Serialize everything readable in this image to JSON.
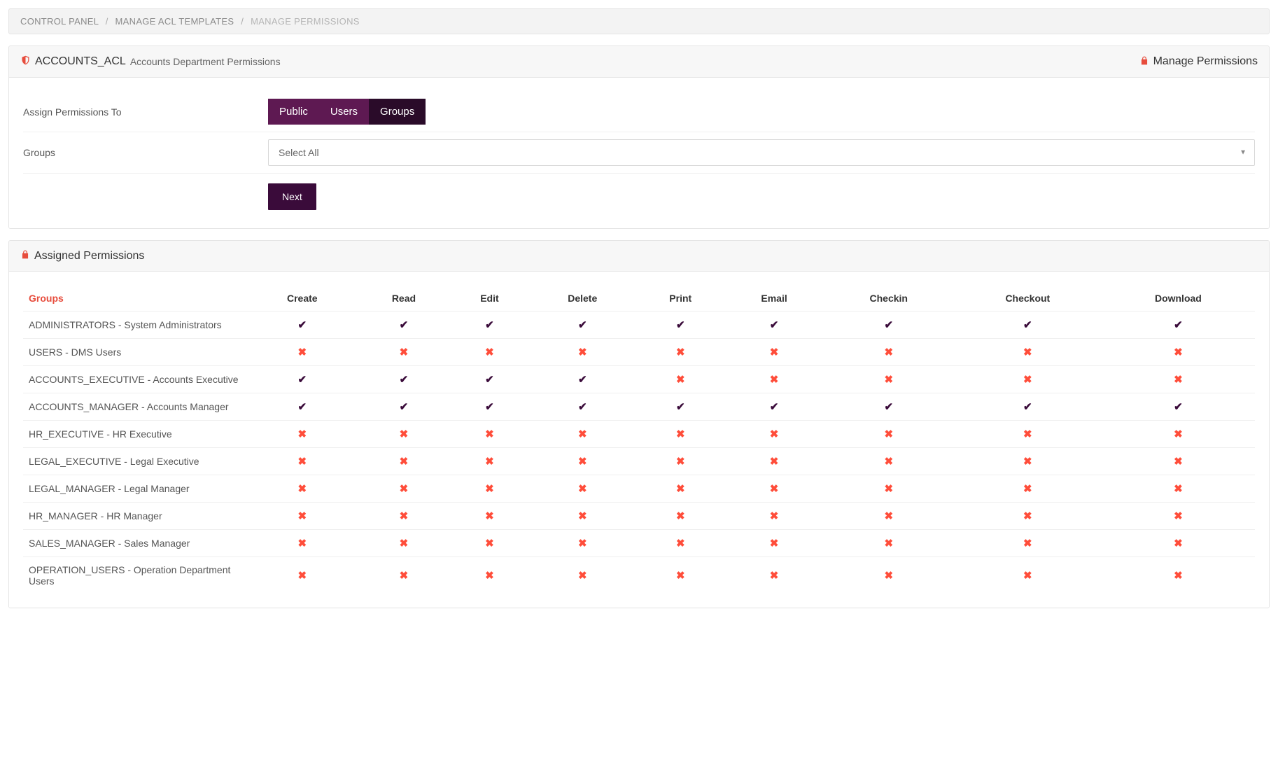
{
  "breadcrumb": {
    "items": [
      {
        "label": "CONTROL PANEL"
      },
      {
        "label": "MANAGE ACL TEMPLATES"
      },
      {
        "label": "MANAGE PERMISSIONS"
      }
    ]
  },
  "acl_panel": {
    "title_main": "ACCOUNTS_ACL",
    "title_sub": "Accounts Department Permissions",
    "header_right": "Manage Permissions",
    "assign_label": "Assign Permissions To",
    "tabs": [
      {
        "label": "Public"
      },
      {
        "label": "Users"
      },
      {
        "label": "Groups"
      }
    ],
    "groups_label": "Groups",
    "groups_select_value": "Select All",
    "next_button": "Next"
  },
  "assigned_panel": {
    "header": "Assigned Permissions",
    "columns": [
      "Groups",
      "Create",
      "Read",
      "Edit",
      "Delete",
      "Print",
      "Email",
      "Checkin",
      "Checkout",
      "Download"
    ],
    "rows": [
      {
        "group": "ADMINISTRATORS - System Administrators",
        "perms": [
          true,
          true,
          true,
          true,
          true,
          true,
          true,
          true,
          true
        ]
      },
      {
        "group": "USERS - DMS Users",
        "perms": [
          false,
          false,
          false,
          false,
          false,
          false,
          false,
          false,
          false
        ]
      },
      {
        "group": "ACCOUNTS_EXECUTIVE - Accounts Executive",
        "perms": [
          true,
          true,
          true,
          true,
          false,
          false,
          false,
          false,
          false
        ]
      },
      {
        "group": "ACCOUNTS_MANAGER - Accounts Manager",
        "perms": [
          true,
          true,
          true,
          true,
          true,
          true,
          true,
          true,
          true
        ]
      },
      {
        "group": "HR_EXECUTIVE - HR Executive",
        "perms": [
          false,
          false,
          false,
          false,
          false,
          false,
          false,
          false,
          false
        ]
      },
      {
        "group": "LEGAL_EXECUTIVE - Legal Executive",
        "perms": [
          false,
          false,
          false,
          false,
          false,
          false,
          false,
          false,
          false
        ]
      },
      {
        "group": "LEGAL_MANAGER - Legal Manager",
        "perms": [
          false,
          false,
          false,
          false,
          false,
          false,
          false,
          false,
          false
        ]
      },
      {
        "group": "HR_MANAGER - HR Manager",
        "perms": [
          false,
          false,
          false,
          false,
          false,
          false,
          false,
          false,
          false
        ]
      },
      {
        "group": "SALES_MANAGER - Sales Manager",
        "perms": [
          false,
          false,
          false,
          false,
          false,
          false,
          false,
          false,
          false
        ]
      },
      {
        "group": "OPERATION_USERS - Operation Department Users",
        "perms": [
          false,
          false,
          false,
          false,
          false,
          false,
          false,
          false,
          false
        ]
      }
    ]
  }
}
